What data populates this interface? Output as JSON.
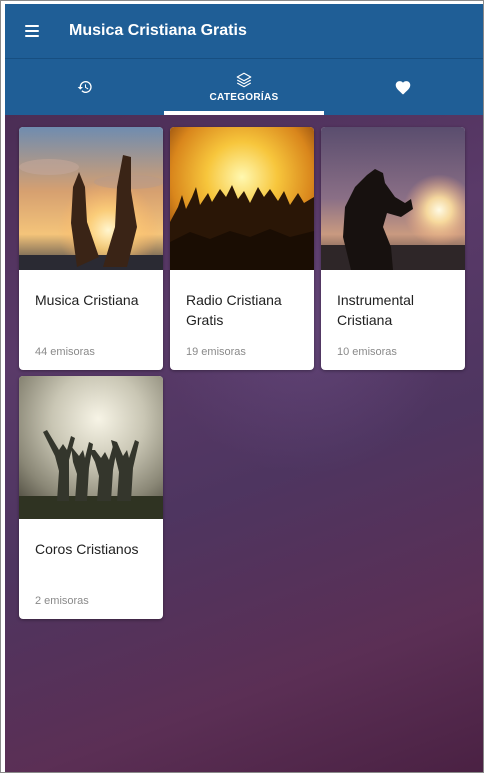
{
  "app": {
    "title": "Musica Cristiana Gratis"
  },
  "tabs": [
    {
      "icon": "history-icon",
      "label": ""
    },
    {
      "icon": "layers-icon",
      "label": "CATEGORÍAS"
    },
    {
      "icon": "heart-icon",
      "label": ""
    }
  ],
  "categories": [
    {
      "title": "Musica Cristiana",
      "count": "44 emisoras",
      "image": "raised-hands-sunset-photo"
    },
    {
      "title": "Radio Cristiana Gratis",
      "count": "19 emisoras",
      "image": "worship-crowd-light-photo"
    },
    {
      "title": "Instrumental Cristiana",
      "count": "10 emisoras",
      "image": "kneeling-prayer-silhouette-photo"
    },
    {
      "title": "Coros Cristianos",
      "count": "2 emisoras",
      "image": "group-arms-raised-sky-photo"
    }
  ],
  "colors": {
    "appbar": "#1f5e96",
    "background": "#4e3560",
    "card": "#ffffff",
    "count_text": "#8a8a8a"
  }
}
